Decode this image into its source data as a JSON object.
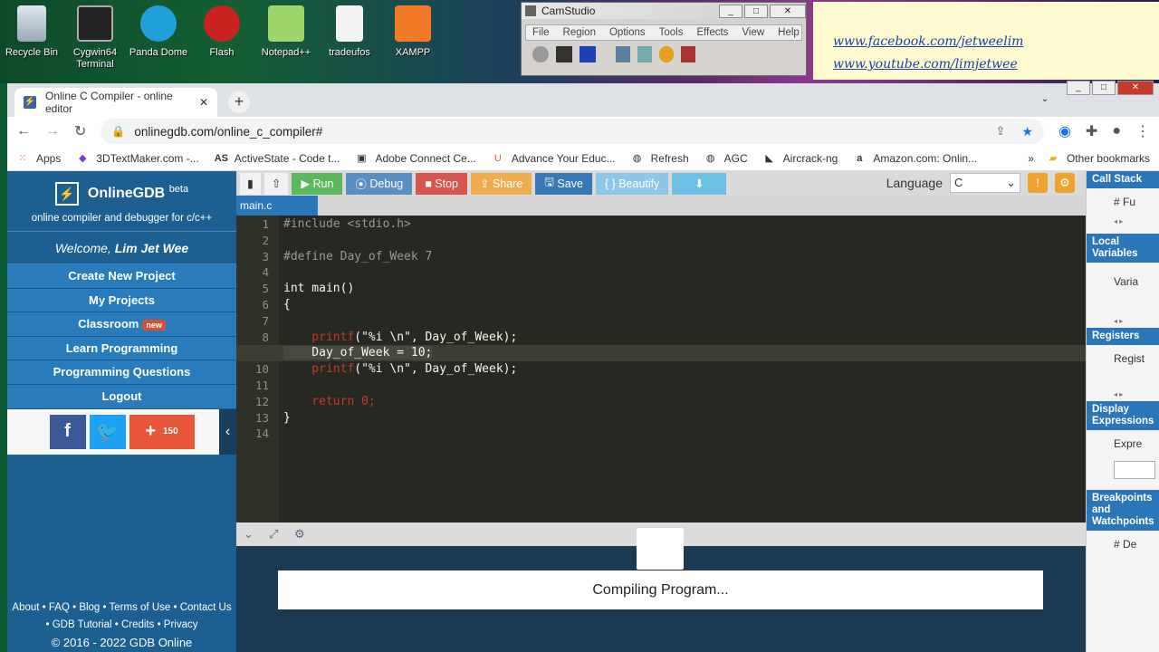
{
  "desktop": {
    "icons": [
      {
        "label": "Recycle Bin",
        "x_label": "Recycle Bin"
      },
      {
        "label": "Cygwin64\nTerminal"
      },
      {
        "label": "Panda Dome"
      },
      {
        "label": "Flash"
      },
      {
        "label": "Notepad++"
      },
      {
        "label": "tradeufos"
      },
      {
        "label": "XAMPP"
      }
    ]
  },
  "camstudio": {
    "title": "CamStudio",
    "menu": [
      "File",
      "Region",
      "Options",
      "Tools",
      "Effects",
      "View",
      "Help"
    ]
  },
  "note": {
    "link1": "www.facebook.com/jetweelim",
    "link2": "www.youtube.com/limjetwee"
  },
  "browser": {
    "tab_title": "Online C Compiler - online editor",
    "url": "onlinegdb.com/online_c_compiler#",
    "bookmarks": [
      "Apps",
      "3DTextMaker.com -...",
      "ActiveState - Code t...",
      "Adobe Connect Ce...",
      "Advance Your Educ...",
      "Refresh",
      "AGC",
      "Aircrack-ng",
      "Amazon.com: Onlin..."
    ],
    "other_bookmarks": "Other bookmarks"
  },
  "sidebar": {
    "brand": "OnlineGDB",
    "brand_sup": "beta",
    "tagline": "online compiler and debugger for c/c++",
    "welcome_prefix": "Welcome, ",
    "welcome_name": "Lim Jet Wee",
    "nav": [
      "Create New Project",
      "My Projects",
      "Classroom",
      "Learn Programming",
      "Programming Questions",
      "Logout"
    ],
    "classroom_badge": "new",
    "share_count": "150",
    "footer_line1": "About • FAQ • Blog • Terms of Use • Contact Us",
    "footer_line2": "• GDB Tutorial • Credits • Privacy",
    "footer_copy": "© 2016 - 2022 GDB Online"
  },
  "toolbar": {
    "run": "Run",
    "debug": "Debug",
    "stop": "Stop",
    "share": "Share",
    "save": "Save",
    "beautify": "{ } Beautify",
    "language_label": "Language",
    "language_value": "C",
    "file_tab": "main.c"
  },
  "editor": {
    "lines": [
      {
        "n": "1",
        "code": "#include <stdio.h>"
      },
      {
        "n": "2",
        "code": ""
      },
      {
        "n": "3",
        "code": "#define Day_of_Week 7"
      },
      {
        "n": "4",
        "code": ""
      },
      {
        "n": "5",
        "code": "int main()"
      },
      {
        "n": "6",
        "code": "{"
      },
      {
        "n": "7",
        "code": ""
      },
      {
        "n": "8",
        "code": "    printf(\"%i \\n\", Day_of_Week);"
      },
      {
        "n": "9",
        "code": "    Day_of_Week = 10;"
      },
      {
        "n": "10",
        "code": "    printf(\"%i \\n\", Day_of_Week);"
      },
      {
        "n": "11",
        "code": ""
      },
      {
        "n": "12",
        "code": "    return 0;"
      },
      {
        "n": "13",
        "code": "}"
      },
      {
        "n": "14",
        "code": ""
      }
    ]
  },
  "output": {
    "status": "Compiling Program..."
  },
  "right_panel": {
    "sections": [
      {
        "title": "Call Stack",
        "cell": "# Fu"
      },
      {
        "title": "Local Variables",
        "cell": "Varia"
      },
      {
        "title": "Registers",
        "cell": "Regist"
      },
      {
        "title": "Display Expressions",
        "cell": "Expre"
      },
      {
        "title": "Breakpoints and Watchpoints",
        "cell": "# De"
      }
    ]
  }
}
